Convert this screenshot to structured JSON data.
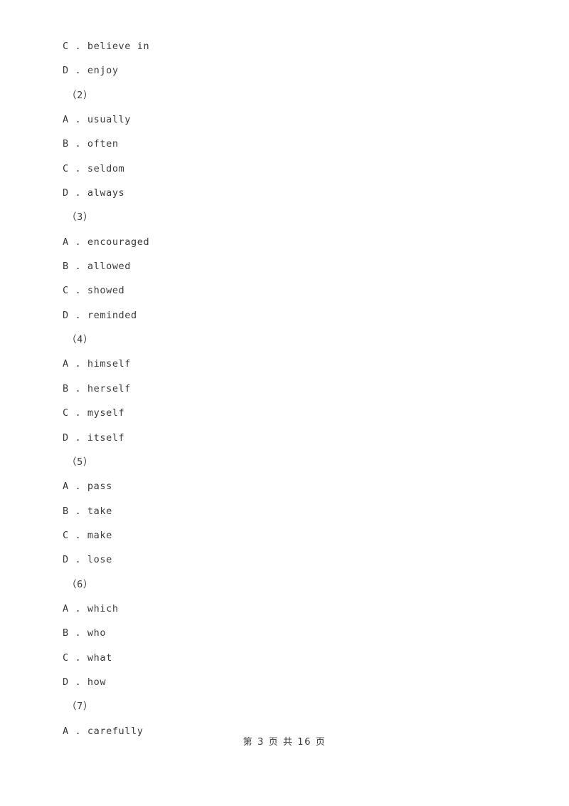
{
  "page": {
    "background_color": "#ffffff",
    "text_color": "#3a3a3a"
  },
  "body": {
    "lines": [
      {
        "type": "option",
        "text": "C . believe in"
      },
      {
        "type": "option",
        "text": "D . enjoy"
      },
      {
        "type": "qnum",
        "text": "（2）"
      },
      {
        "type": "option",
        "text": "A . usually"
      },
      {
        "type": "option",
        "text": "B . often"
      },
      {
        "type": "option",
        "text": "C . seldom"
      },
      {
        "type": "option",
        "text": "D . always"
      },
      {
        "type": "qnum",
        "text": "（3）"
      },
      {
        "type": "option",
        "text": "A . encouraged"
      },
      {
        "type": "option",
        "text": "B . allowed"
      },
      {
        "type": "option",
        "text": "C . showed"
      },
      {
        "type": "option",
        "text": "D . reminded"
      },
      {
        "type": "qnum",
        "text": "（4）"
      },
      {
        "type": "option",
        "text": "A . himself"
      },
      {
        "type": "option",
        "text": "B . herself"
      },
      {
        "type": "option",
        "text": "C . myself"
      },
      {
        "type": "option",
        "text": "D . itself"
      },
      {
        "type": "qnum",
        "text": "（5）"
      },
      {
        "type": "option",
        "text": "A . pass"
      },
      {
        "type": "option",
        "text": "B . take"
      },
      {
        "type": "option",
        "text": "C . make"
      },
      {
        "type": "option",
        "text": "D . lose"
      },
      {
        "type": "qnum",
        "text": "（6）"
      },
      {
        "type": "option",
        "text": "A . which"
      },
      {
        "type": "option",
        "text": "B . who"
      },
      {
        "type": "option",
        "text": "C . what"
      },
      {
        "type": "option",
        "text": "D . how"
      },
      {
        "type": "qnum",
        "text": "（7）"
      },
      {
        "type": "option",
        "text": "A . carefully"
      }
    ]
  },
  "footer": {
    "text": "第 3 页 共 16 页",
    "current_page": "3",
    "total_pages": "16"
  }
}
